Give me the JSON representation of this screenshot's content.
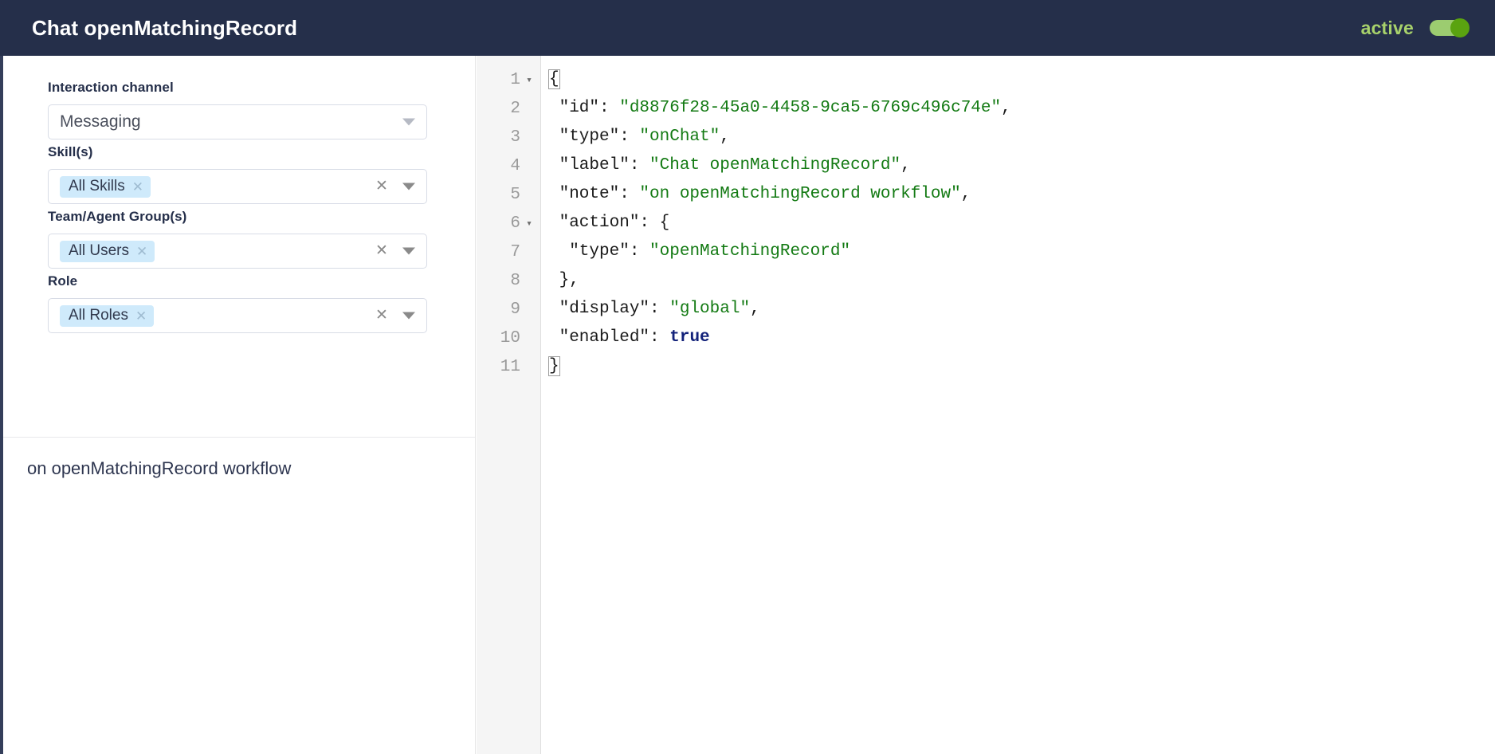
{
  "header": {
    "title": "Chat openMatchingRecord",
    "status_label": "active",
    "status_color": "#a8d26b",
    "toggle_on": true,
    "toggle_track_color": "#9ccc70",
    "toggle_knob_color": "#5aa310",
    "background_color": "#252f4a"
  },
  "form": {
    "fields": [
      {
        "label": "Interaction channel",
        "kind": "select",
        "value": "Messaging",
        "icon": "chevron-down-icon"
      },
      {
        "label": "Skill(s)",
        "kind": "multiselect",
        "chips": [
          "All Skills"
        ],
        "clear_icon": "close-icon",
        "icon": "chevron-down-icon"
      },
      {
        "label": "Team/Agent Group(s)",
        "kind": "multiselect",
        "chips": [
          "All Users"
        ],
        "clear_icon": "close-icon",
        "icon": "chevron-down-icon"
      },
      {
        "label": "Role",
        "kind": "multiselect",
        "chips": [
          "All Roles"
        ],
        "clear_icon": "close-icon",
        "icon": "chevron-down-icon"
      }
    ],
    "chip_background": "#cfeafb",
    "note": "on openMatchingRecord workflow"
  },
  "editor": {
    "language": "json",
    "total_lines": 11,
    "lines": [
      {
        "n": 1,
        "foldable": true,
        "segments": [
          {
            "t": "{",
            "c": "brace-match"
          }
        ]
      },
      {
        "n": 2,
        "foldable": false,
        "segments": [
          {
            "t": " \"id\": ",
            "c": "plain"
          },
          {
            "t": "\"d8876f28-45a0-4458-9ca5-6769c496c74e\"",
            "c": "str"
          },
          {
            "t": ",",
            "c": "plain"
          }
        ]
      },
      {
        "n": 3,
        "foldable": false,
        "segments": [
          {
            "t": " \"type\": ",
            "c": "plain"
          },
          {
            "t": "\"onChat\"",
            "c": "str"
          },
          {
            "t": ",",
            "c": "plain"
          }
        ]
      },
      {
        "n": 4,
        "foldable": false,
        "segments": [
          {
            "t": " \"label\": ",
            "c": "plain"
          },
          {
            "t": "\"Chat openMatchingRecord\"",
            "c": "str"
          },
          {
            "t": ",",
            "c": "plain"
          }
        ]
      },
      {
        "n": 5,
        "foldable": false,
        "segments": [
          {
            "t": " \"note\": ",
            "c": "plain"
          },
          {
            "t": "\"on openMatchingRecord workflow\"",
            "c": "str"
          },
          {
            "t": ",",
            "c": "plain"
          }
        ]
      },
      {
        "n": 6,
        "foldable": true,
        "segments": [
          {
            "t": " \"action\": {",
            "c": "plain"
          }
        ]
      },
      {
        "n": 7,
        "foldable": false,
        "segments": [
          {
            "t": "  \"type\": ",
            "c": "plain"
          },
          {
            "t": "\"openMatchingRecord\"",
            "c": "str"
          }
        ]
      },
      {
        "n": 8,
        "foldable": false,
        "segments": [
          {
            "t": " },",
            "c": "plain"
          }
        ]
      },
      {
        "n": 9,
        "foldable": false,
        "segments": [
          {
            "t": " \"display\": ",
            "c": "plain"
          },
          {
            "t": "\"global\"",
            "c": "str"
          },
          {
            "t": ",",
            "c": "plain"
          }
        ]
      },
      {
        "n": 10,
        "foldable": false,
        "segments": [
          {
            "t": " \"enabled\": ",
            "c": "plain"
          },
          {
            "t": "true",
            "c": "bool"
          }
        ]
      },
      {
        "n": 11,
        "foldable": false,
        "segments": [
          {
            "t": "}",
            "c": "brace-match"
          }
        ]
      }
    ],
    "fold_glyph": "▾",
    "string_color": "#137a13",
    "boolean_color": "#13227a",
    "gutter_background": "#f5f5f5"
  }
}
